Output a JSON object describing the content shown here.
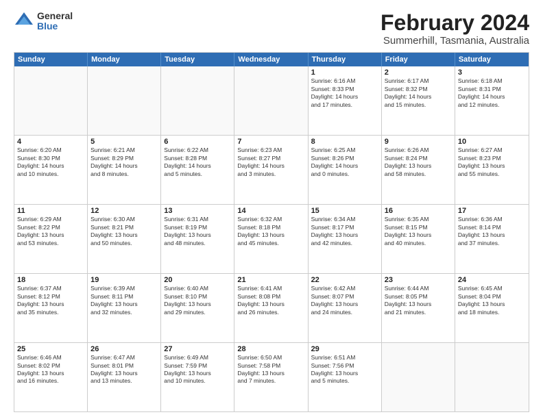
{
  "logo": {
    "general": "General",
    "blue": "Blue"
  },
  "title": "February 2024",
  "subtitle": "Summerhill, Tasmania, Australia",
  "header_days": [
    "Sunday",
    "Monday",
    "Tuesday",
    "Wednesday",
    "Thursday",
    "Friday",
    "Saturday"
  ],
  "weeks": [
    [
      {
        "day": "",
        "info": ""
      },
      {
        "day": "",
        "info": ""
      },
      {
        "day": "",
        "info": ""
      },
      {
        "day": "",
        "info": ""
      },
      {
        "day": "1",
        "info": "Sunrise: 6:16 AM\nSunset: 8:33 PM\nDaylight: 14 hours\nand 17 minutes."
      },
      {
        "day": "2",
        "info": "Sunrise: 6:17 AM\nSunset: 8:32 PM\nDaylight: 14 hours\nand 15 minutes."
      },
      {
        "day": "3",
        "info": "Sunrise: 6:18 AM\nSunset: 8:31 PM\nDaylight: 14 hours\nand 12 minutes."
      }
    ],
    [
      {
        "day": "4",
        "info": "Sunrise: 6:20 AM\nSunset: 8:30 PM\nDaylight: 14 hours\nand 10 minutes."
      },
      {
        "day": "5",
        "info": "Sunrise: 6:21 AM\nSunset: 8:29 PM\nDaylight: 14 hours\nand 8 minutes."
      },
      {
        "day": "6",
        "info": "Sunrise: 6:22 AM\nSunset: 8:28 PM\nDaylight: 14 hours\nand 5 minutes."
      },
      {
        "day": "7",
        "info": "Sunrise: 6:23 AM\nSunset: 8:27 PM\nDaylight: 14 hours\nand 3 minutes."
      },
      {
        "day": "8",
        "info": "Sunrise: 6:25 AM\nSunset: 8:26 PM\nDaylight: 14 hours\nand 0 minutes."
      },
      {
        "day": "9",
        "info": "Sunrise: 6:26 AM\nSunset: 8:24 PM\nDaylight: 13 hours\nand 58 minutes."
      },
      {
        "day": "10",
        "info": "Sunrise: 6:27 AM\nSunset: 8:23 PM\nDaylight: 13 hours\nand 55 minutes."
      }
    ],
    [
      {
        "day": "11",
        "info": "Sunrise: 6:29 AM\nSunset: 8:22 PM\nDaylight: 13 hours\nand 53 minutes."
      },
      {
        "day": "12",
        "info": "Sunrise: 6:30 AM\nSunset: 8:21 PM\nDaylight: 13 hours\nand 50 minutes."
      },
      {
        "day": "13",
        "info": "Sunrise: 6:31 AM\nSunset: 8:19 PM\nDaylight: 13 hours\nand 48 minutes."
      },
      {
        "day": "14",
        "info": "Sunrise: 6:32 AM\nSunset: 8:18 PM\nDaylight: 13 hours\nand 45 minutes."
      },
      {
        "day": "15",
        "info": "Sunrise: 6:34 AM\nSunset: 8:17 PM\nDaylight: 13 hours\nand 42 minutes."
      },
      {
        "day": "16",
        "info": "Sunrise: 6:35 AM\nSunset: 8:15 PM\nDaylight: 13 hours\nand 40 minutes."
      },
      {
        "day": "17",
        "info": "Sunrise: 6:36 AM\nSunset: 8:14 PM\nDaylight: 13 hours\nand 37 minutes."
      }
    ],
    [
      {
        "day": "18",
        "info": "Sunrise: 6:37 AM\nSunset: 8:12 PM\nDaylight: 13 hours\nand 35 minutes."
      },
      {
        "day": "19",
        "info": "Sunrise: 6:39 AM\nSunset: 8:11 PM\nDaylight: 13 hours\nand 32 minutes."
      },
      {
        "day": "20",
        "info": "Sunrise: 6:40 AM\nSunset: 8:10 PM\nDaylight: 13 hours\nand 29 minutes."
      },
      {
        "day": "21",
        "info": "Sunrise: 6:41 AM\nSunset: 8:08 PM\nDaylight: 13 hours\nand 26 minutes."
      },
      {
        "day": "22",
        "info": "Sunrise: 6:42 AM\nSunset: 8:07 PM\nDaylight: 13 hours\nand 24 minutes."
      },
      {
        "day": "23",
        "info": "Sunrise: 6:44 AM\nSunset: 8:05 PM\nDaylight: 13 hours\nand 21 minutes."
      },
      {
        "day": "24",
        "info": "Sunrise: 6:45 AM\nSunset: 8:04 PM\nDaylight: 13 hours\nand 18 minutes."
      }
    ],
    [
      {
        "day": "25",
        "info": "Sunrise: 6:46 AM\nSunset: 8:02 PM\nDaylight: 13 hours\nand 16 minutes."
      },
      {
        "day": "26",
        "info": "Sunrise: 6:47 AM\nSunset: 8:01 PM\nDaylight: 13 hours\nand 13 minutes."
      },
      {
        "day": "27",
        "info": "Sunrise: 6:49 AM\nSunset: 7:59 PM\nDaylight: 13 hours\nand 10 minutes."
      },
      {
        "day": "28",
        "info": "Sunrise: 6:50 AM\nSunset: 7:58 PM\nDaylight: 13 hours\nand 7 minutes."
      },
      {
        "day": "29",
        "info": "Sunrise: 6:51 AM\nSunset: 7:56 PM\nDaylight: 13 hours\nand 5 minutes."
      },
      {
        "day": "",
        "info": ""
      },
      {
        "day": "",
        "info": ""
      }
    ]
  ]
}
